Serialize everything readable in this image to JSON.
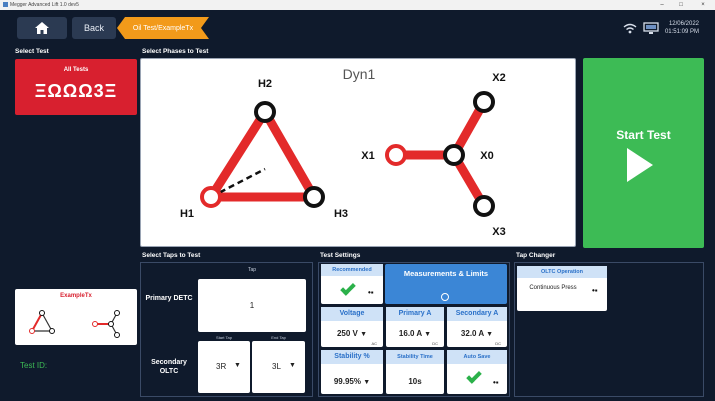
{
  "window": {
    "title": "Megger Advanced Lift 1.0 dev5",
    "minimize": "–",
    "maximize": "□",
    "close": "×"
  },
  "nav": {
    "back_label": "Back",
    "breadcrumb": "Oil Test/ExampleTx"
  },
  "status": {
    "date": "12/06/2022",
    "time": "01:51:09 PM"
  },
  "select_test": {
    "label": "Select Test",
    "all_tests_label": "All Tests",
    "icons_text": "ΞΩΩΩ3Ξ"
  },
  "phases": {
    "label": "Select Phases to Test",
    "vector_group": "Dyn1",
    "nodes": {
      "h1": "H1",
      "h2": "H2",
      "h3": "H3",
      "x0": "X0",
      "x1": "X1",
      "x2": "X2",
      "x3": "X3"
    }
  },
  "start_test": {
    "label": "Start Test"
  },
  "example": {
    "label": "ExampleTx"
  },
  "test_id": {
    "label": "Test ID:"
  },
  "taps": {
    "label": "Select Taps to Test",
    "tap_header": "Tap",
    "primary_label": "Primary DETC",
    "primary_value": "1",
    "secondary_label": "Secondary OLTC",
    "start_tap_label": "Start Tap",
    "end_tap_label": "End Tap",
    "start_tap_value": "3R",
    "end_tap_value": "3L"
  },
  "settings": {
    "label": "Test Settings",
    "recommended": "Recommended",
    "measurements": "Measurements & Limits",
    "voltage": {
      "label": "Voltage",
      "value": "250 V",
      "unit": "AC"
    },
    "primary_a": {
      "label": "Primary A",
      "value": "16.0 A",
      "unit": "DC"
    },
    "secondary_a": {
      "label": "Secondary A",
      "value": "32.0 A",
      "unit": "DC"
    },
    "stability_pct": {
      "label": "Stability %",
      "value": "99.95%"
    },
    "stability_time": {
      "label": "Stability Time",
      "value": "10s"
    },
    "auto_save": {
      "label": "Auto Save"
    }
  },
  "tap_changer": {
    "label": "Tap Changer",
    "oltc_label": "OLTC Operation",
    "oltc_value": "Continuous Press"
  },
  "colors": {
    "accent_red": "#d8202f",
    "accent_green": "#3dbb55",
    "accent_blue": "#3b86d6",
    "accent_orange": "#f29a1a",
    "background": "#0f1a2c"
  }
}
